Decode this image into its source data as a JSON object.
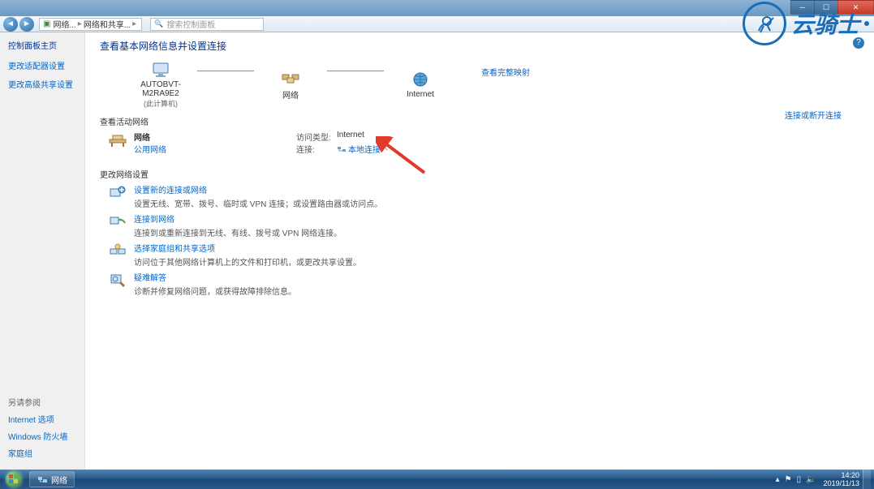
{
  "window": {
    "breadcrumb": {
      "icon_label": "",
      "item1": "网络...",
      "item2": "网络和共享..."
    },
    "search_placeholder": "搜索控制面板"
  },
  "sidebar": {
    "heading": "控制面板主页",
    "links": [
      "更改适配器设置",
      "更改高级共享设置"
    ],
    "footer_label": "另请参阅",
    "footer_links": [
      "Internet 选项",
      "Windows 防火墙",
      "家庭组"
    ]
  },
  "content": {
    "title": "查看基本网络信息并设置连接",
    "view_full_map": "查看完整映射",
    "nodes": {
      "computer": {
        "name": "AUTOBVT-M2RA9E2",
        "sub": "(此计算机)"
      },
      "network": {
        "name": "网络"
      },
      "internet": {
        "name": "Internet"
      }
    },
    "active_title": "查看活动网络",
    "connect_disconnect": "连接或断开连接",
    "active": {
      "name": "网络",
      "type_link": "公用网络",
      "access_label": "访问类型:",
      "access_value": "Internet",
      "conn_label": "连接:",
      "conn_value": "本地连接"
    },
    "change_title": "更改网络设置",
    "tasks": [
      {
        "link": "设置新的连接或网络",
        "desc": "设置无线、宽带、拨号、临时或 VPN 连接；或设置路由器或访问点。"
      },
      {
        "link": "连接到网络",
        "desc": "连接到或重新连接到无线、有线、拨号或 VPN 网络连接。"
      },
      {
        "link": "选择家庭组和共享选项",
        "desc": "访问位于其他网络计算机上的文件和打印机，或更改共享设置。"
      },
      {
        "link": "疑难解答",
        "desc": "诊断并修复网络问题，或获得故障排除信息。"
      }
    ]
  },
  "taskbar": {
    "app": "网络",
    "time": "14:20",
    "date": "2019/11/13"
  },
  "watermark": {
    "text": "云骑士"
  }
}
